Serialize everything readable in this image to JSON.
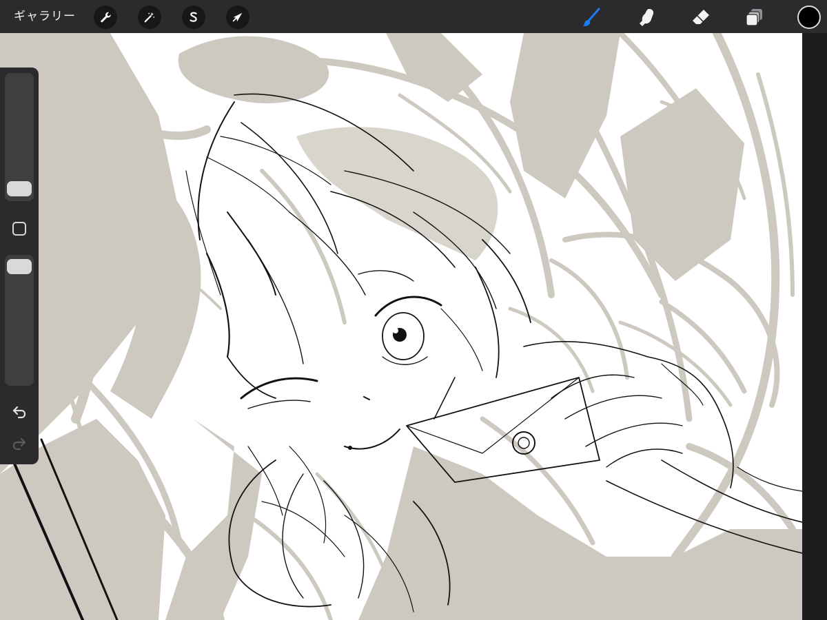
{
  "toolbar": {
    "gallery_label": "ギャラリー",
    "actions": [
      {
        "name": "actions-button",
        "icon": "wrench-icon"
      },
      {
        "name": "adjustments-button",
        "icon": "magic-wand-icon"
      },
      {
        "name": "selection-button",
        "icon": "selection-s-icon"
      },
      {
        "name": "transform-button",
        "icon": "arrow-cursor-icon"
      }
    ],
    "tools": [
      {
        "name": "brush-tool-button",
        "icon": "brush-icon",
        "active": true
      },
      {
        "name": "smudge-tool-button",
        "icon": "smudge-finger-icon",
        "active": false
      },
      {
        "name": "eraser-tool-button",
        "icon": "eraser-icon",
        "active": false
      },
      {
        "name": "layers-button",
        "icon": "layers-icon",
        "active": false
      }
    ],
    "current_color": "#000000",
    "active_tool_color": "#1c7cf4"
  },
  "sidebar": {
    "brush_size_slider": {
      "icon": "brush-size-slider"
    },
    "modify_button": {
      "icon": "square-icon"
    },
    "opacity_slider": {
      "icon": "opacity-slider"
    },
    "undo": {
      "icon": "undo-arrow-icon"
    },
    "redo": {
      "icon": "redo-arrow-icon",
      "enabled": false
    }
  },
  "canvas": {
    "background": "#ffffff",
    "sketch_layer_color": "#cdc9c0",
    "lineart_color": "#111111"
  }
}
